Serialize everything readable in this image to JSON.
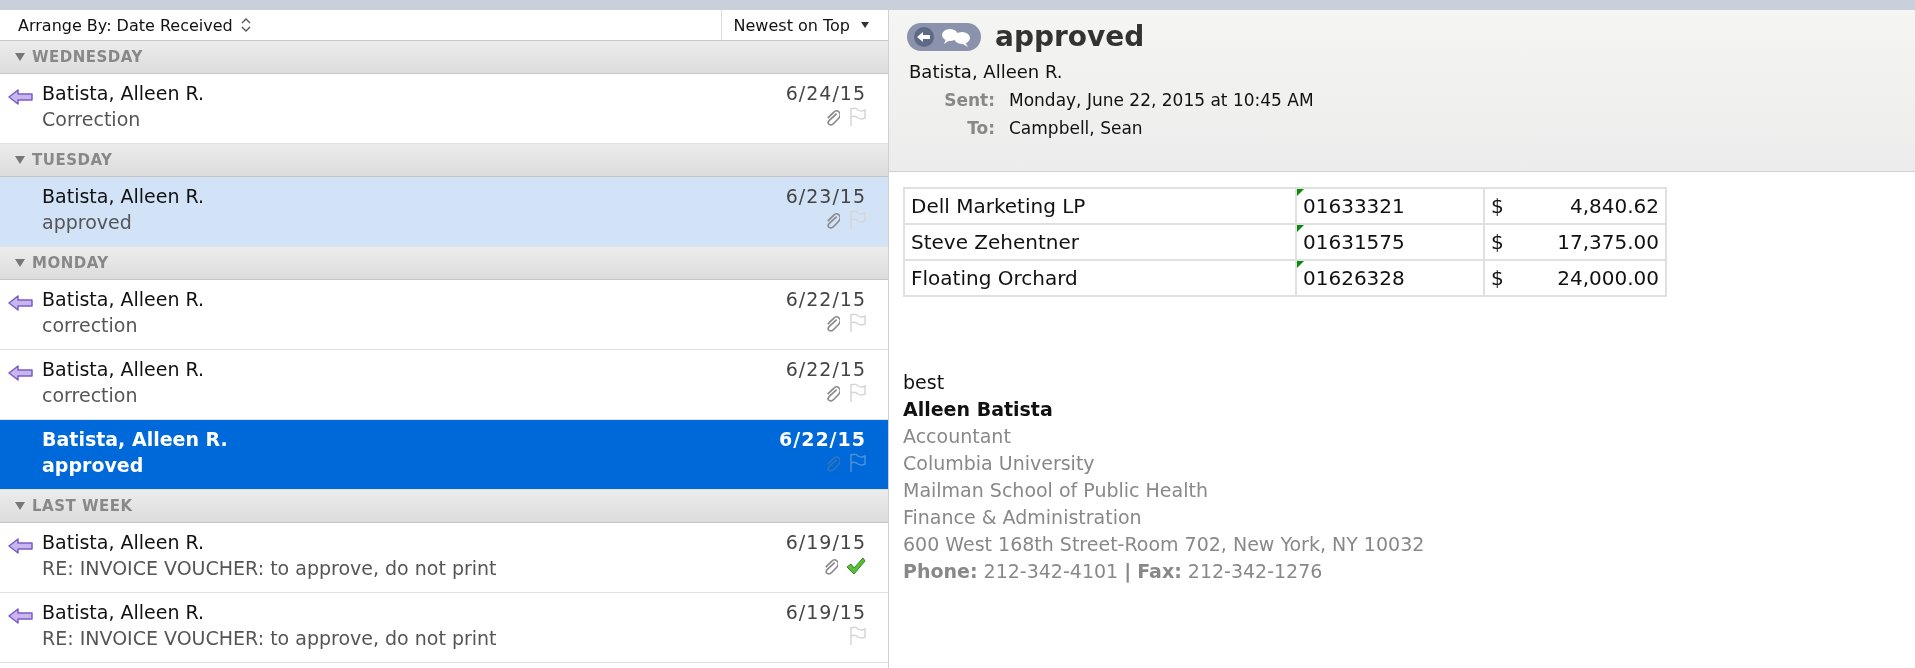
{
  "list_header": {
    "arrange_by": "Arrange By: Date Received",
    "sort_order": "Newest on Top"
  },
  "groups": [
    {
      "label": "WEDNESDAY",
      "expanded": true,
      "messages": [
        {
          "sender": "Batista, Alleen R.",
          "subject": "Correction",
          "date": "6/24/15",
          "replied": true,
          "attachment": true,
          "completed": false,
          "selected": false,
          "highlighted": false
        }
      ]
    },
    {
      "label": "TUESDAY",
      "expanded": true,
      "messages": [
        {
          "sender": "Batista, Alleen R.",
          "subject": "approved",
          "date": "6/23/15",
          "replied": false,
          "attachment": true,
          "completed": false,
          "selected": false,
          "highlighted": true
        }
      ]
    },
    {
      "label": "MONDAY",
      "expanded": true,
      "messages": [
        {
          "sender": "Batista, Alleen R.",
          "subject": "correction",
          "date": "6/22/15",
          "replied": true,
          "attachment": true,
          "completed": false,
          "selected": false,
          "highlighted": false
        },
        {
          "sender": "Batista, Alleen R.",
          "subject": "correction",
          "date": "6/22/15",
          "replied": true,
          "attachment": true,
          "completed": false,
          "selected": false,
          "highlighted": false
        },
        {
          "sender": "Batista, Alleen R.",
          "subject": "approved",
          "date": "6/22/15",
          "replied": false,
          "attachment": true,
          "completed": false,
          "selected": true,
          "highlighted": false
        }
      ]
    },
    {
      "label": "LAST WEEK",
      "expanded": true,
      "messages": [
        {
          "sender": "Batista, Alleen R.",
          "subject": "RE: INVOICE VOUCHER: to approve, do not print",
          "date": "6/19/15",
          "replied": true,
          "attachment": true,
          "completed": true,
          "selected": false,
          "highlighted": false
        },
        {
          "sender": "Batista, Alleen R.",
          "subject": "RE: INVOICE VOUCHER: to approve, do not print",
          "date": "6/19/15",
          "replied": true,
          "attachment": false,
          "completed": false,
          "selected": false,
          "highlighted": false
        }
      ]
    }
  ],
  "message": {
    "title": "approved",
    "sender": "Batista, Alleen R.",
    "fields": [
      {
        "label": "Sent:",
        "value": "Monday, June 22, 2015 at 10:45 AM"
      },
      {
        "label": "To:",
        "value": "Campbell, Sean"
      }
    ],
    "table": {
      "rows": [
        {
          "name": "Dell Marketing LP",
          "code": "01633321",
          "currency": "$",
          "amount": "4,840.62"
        },
        {
          "name": "Steve Zehentner",
          "code": "01631575",
          "currency": "$",
          "amount": "17,375.00"
        },
        {
          "name": "Floating Orchard",
          "code": "01626328",
          "currency": "$",
          "amount": "24,000.00"
        }
      ]
    },
    "signature": {
      "greeting": "best",
      "name": "Alleen Batista",
      "lines": [
        "Accountant",
        "Columbia University",
        "Mailman School of Public Health",
        "Finance & Administration",
        "600 West 168th Street-Room 702, New York, NY 10032"
      ],
      "contact": "**Phone:** 212-342-4101 **|** **Fax:** 212-342-1276"
    }
  }
}
